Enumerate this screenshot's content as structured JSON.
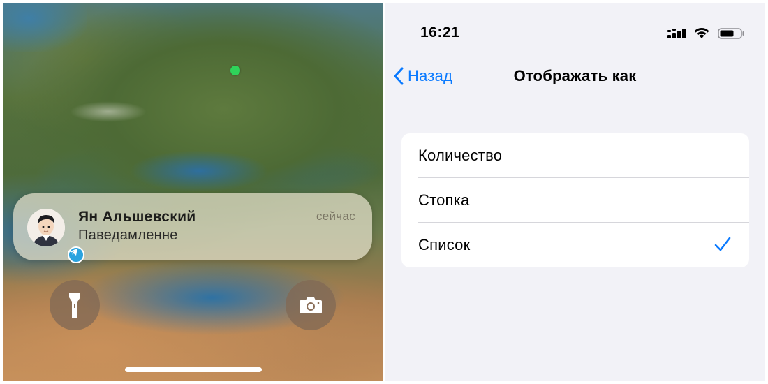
{
  "lock_screen": {
    "notification": {
      "sender": "Ян Альшевский",
      "message": "Паведамленне",
      "time": "сейчас",
      "app_icon": "telegram-icon"
    },
    "buttons": [
      {
        "name": "flashlight",
        "icon": "flashlight-icon"
      },
      {
        "name": "camera",
        "icon": "camera-icon"
      }
    ],
    "location_dot_color": "#2fd35a"
  },
  "settings": {
    "status_bar": {
      "time": "16:21",
      "icons": [
        "cellular-signal-icon",
        "wifi-icon",
        "battery-icon"
      ]
    },
    "nav": {
      "back_label": "Назад",
      "title": "Отображать как"
    },
    "options": [
      {
        "label": "Количество",
        "selected": false
      },
      {
        "label": "Стопка",
        "selected": false
      },
      {
        "label": "Список",
        "selected": true
      }
    ],
    "accent_color": "#0a7aff"
  }
}
